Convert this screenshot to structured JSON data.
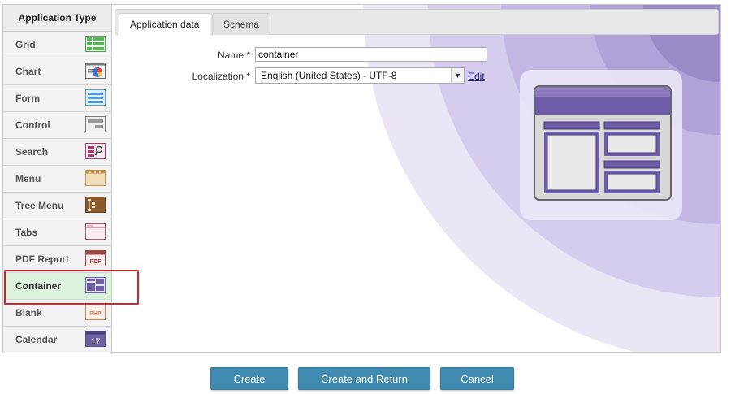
{
  "sidebar": {
    "header": "Application Type",
    "items": [
      {
        "label": "Grid",
        "icon": "grid-icon"
      },
      {
        "label": "Chart",
        "icon": "chart-icon"
      },
      {
        "label": "Form",
        "icon": "form-icon"
      },
      {
        "label": "Control",
        "icon": "control-icon"
      },
      {
        "label": "Search",
        "icon": "search-icon"
      },
      {
        "label": "Menu",
        "icon": "menu-icon"
      },
      {
        "label": "Tree Menu",
        "icon": "tree-menu-icon"
      },
      {
        "label": "Tabs",
        "icon": "tabs-icon"
      },
      {
        "label": "PDF Report",
        "icon": "pdf-report-icon"
      },
      {
        "label": "Container",
        "icon": "container-icon",
        "selected": true
      },
      {
        "label": "Blank",
        "icon": "blank-php-icon"
      },
      {
        "label": "Calendar",
        "icon": "calendar-icon"
      }
    ],
    "icon_texts": {
      "pdf": "PDF",
      "php": "PHP",
      "calendar": "17"
    }
  },
  "tabs": [
    {
      "label": "Application data",
      "active": true
    },
    {
      "label": "Schema",
      "active": false
    }
  ],
  "form": {
    "name_label": "Name *",
    "name_value": "container",
    "localization_label": "Localization *",
    "localization_value": "English (United States) - UTF-8",
    "edit_link": "Edit"
  },
  "buttons": {
    "create": "Create",
    "create_and_return": "Create and Return",
    "cancel": "Cancel"
  },
  "colors": {
    "accent_button": "#3f8aae",
    "selected_item_bg": "#ddf3dd",
    "highlight_border": "#d0272c",
    "purple_primary": "#8e79b8",
    "purple_light": "#e6dff3"
  }
}
